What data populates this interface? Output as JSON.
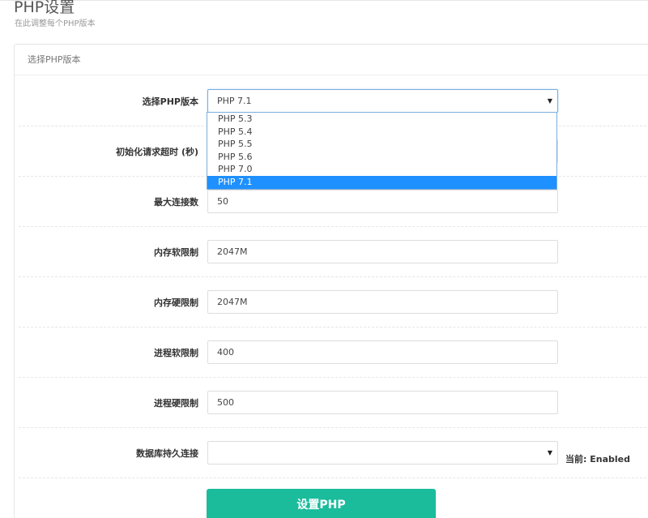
{
  "header": {
    "title": "PHP设置",
    "subtitle": "在此调整每个PHP版本"
  },
  "panel": {
    "heading": "选择PHP版本"
  },
  "form": {
    "php_version": {
      "label": "选择PHP版本",
      "value": "PHP 7.1"
    },
    "init_timeout": {
      "label": "初始化请求超时 (秒)"
    },
    "max_connections": {
      "label": "最大连接数",
      "value": "50"
    },
    "memory_soft": {
      "label": "内存软限制",
      "value": "2047M"
    },
    "memory_hard": {
      "label": "内存硬限制",
      "value": "2047M"
    },
    "process_soft": {
      "label": "进程软限制",
      "value": "400"
    },
    "process_hard": {
      "label": "进程硬限制",
      "value": "500"
    },
    "db_persistent": {
      "label": "数据库持久连接",
      "value": "",
      "current_hint": "当前: Enabled"
    }
  },
  "dropdown": {
    "options": [
      "PHP 5.3",
      "PHP 5.4",
      "PHP 5.5",
      "PHP 5.6",
      "PHP 7.0",
      "PHP 7.1"
    ],
    "selected": "PHP 7.1"
  },
  "actions": {
    "submit_label": "设置PHP"
  },
  "colors": {
    "accent": "#1abc9c",
    "selection": "#1e90ff",
    "focus_border": "#7aaedc"
  }
}
